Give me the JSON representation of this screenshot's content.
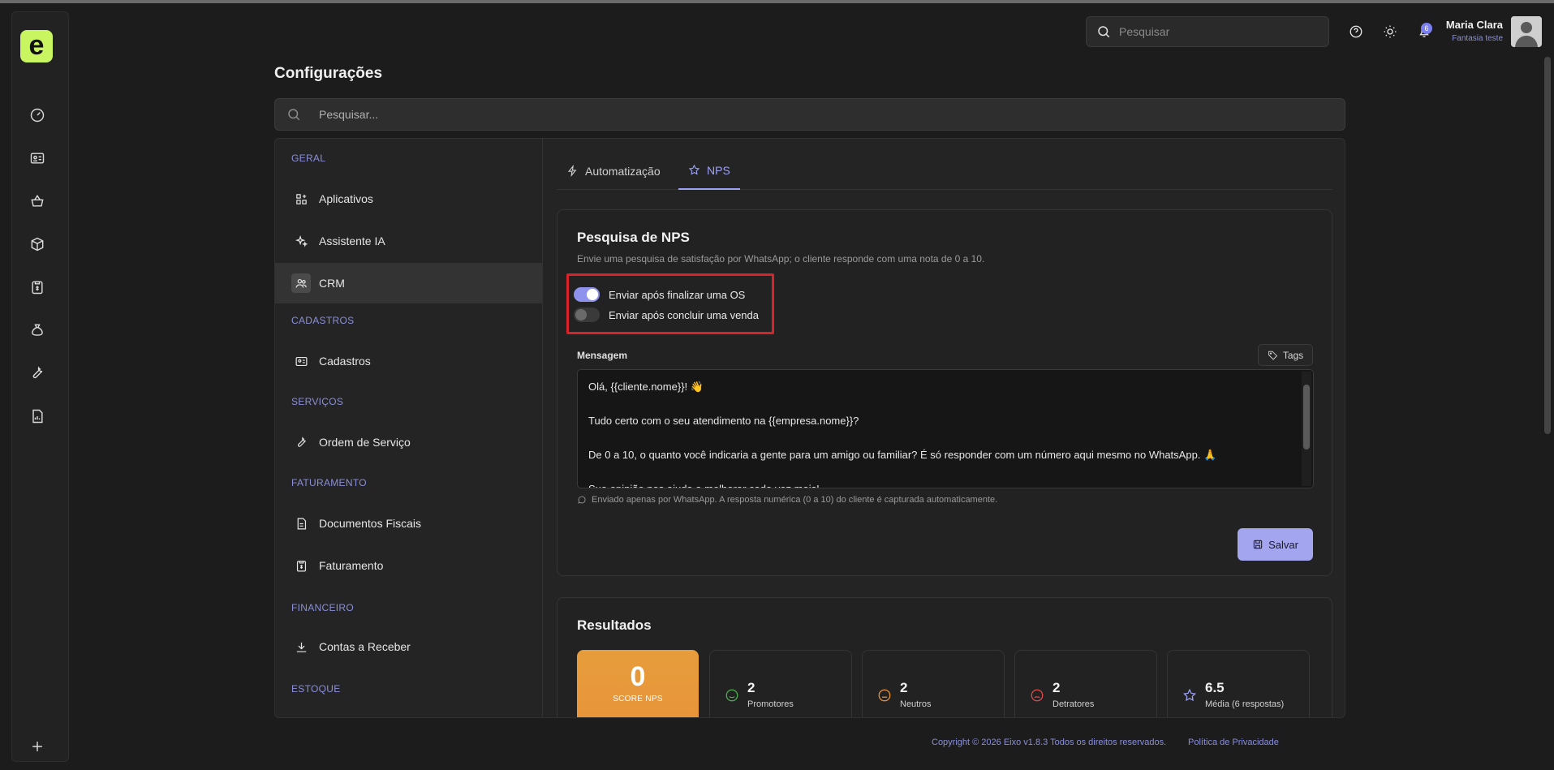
{
  "header": {
    "search_placeholder": "Pesquisar",
    "notifications_count": "6",
    "user_name": "Maria Clara",
    "user_company": "Fantasia teste"
  },
  "page": {
    "title": "Configurações",
    "search_placeholder": "Pesquisar..."
  },
  "sidebar": {
    "sections": [
      {
        "label": "GERAL"
      },
      {
        "label": "CADASTROS"
      },
      {
        "label": "SERVIÇOS"
      },
      {
        "label": "FATURAMENTO"
      },
      {
        "label": "FINANCEIRO"
      },
      {
        "label": "ESTOQUE"
      }
    ],
    "items": [
      {
        "label": "Aplicativos",
        "icon": "apps-icon"
      },
      {
        "label": "Assistente IA",
        "icon": "sparkles-icon"
      },
      {
        "label": "CRM",
        "icon": "users-icon",
        "active": true
      },
      {
        "label": "Cadastros",
        "icon": "id-card-icon"
      },
      {
        "label": "Ordem de Serviço",
        "icon": "wrench-icon"
      },
      {
        "label": "Documentos Fiscais",
        "icon": "document-icon"
      },
      {
        "label": "Faturamento",
        "icon": "clipboard-dollar-icon"
      },
      {
        "label": "Contas a Receber",
        "icon": "download-icon"
      }
    ]
  },
  "tabs": [
    {
      "label": "Automatização",
      "icon": "lightning-icon",
      "active": false
    },
    {
      "label": "NPS",
      "icon": "star-icon",
      "active": true
    }
  ],
  "nps": {
    "title": "Pesquisa de NPS",
    "description": "Envie uma pesquisa de satisfação por WhatsApp; o cliente responde com uma nota de 0 a 10.",
    "toggles": [
      {
        "label": "Enviar após finalizar uma OS",
        "on": true
      },
      {
        "label": "Enviar após concluir uma venda",
        "on": false
      }
    ],
    "message_label": "Mensagem",
    "tags_label": "Tags",
    "message_lines": [
      "Olá, {{cliente.nome}}! 👋",
      "",
      "Tudo certo com o seu atendimento na {{empresa.nome}}?",
      "",
      "De 0 a 10, o quanto você indicaria a gente para um amigo ou familiar? É só responder com um número aqui mesmo no WhatsApp. 🙏",
      "",
      "Sua opinião nos ajuda a melhorar cada vez mais!"
    ],
    "hint": "Enviado apenas por WhatsApp. A resposta numérica (0 a 10) do cliente é capturada automaticamente.",
    "save_label": "Salvar"
  },
  "results": {
    "title": "Resultados",
    "score_value": "0",
    "score_label": "SCORE NPS",
    "stats": [
      {
        "value": "2",
        "label": "Promotores",
        "icon": "smile-icon",
        "color": "#4caf50"
      },
      {
        "value": "2",
        "label": "Neutros",
        "icon": "neutral-face-icon",
        "color": "#e8923a"
      },
      {
        "value": "2",
        "label": "Detratores",
        "icon": "sad-face-icon",
        "color": "#e24b4b"
      },
      {
        "value": "6.5",
        "label": "Média (6 respostas)",
        "icon": "star-icon",
        "color": "#9ea2f5"
      }
    ]
  },
  "footer": {
    "copyright": "Copyright © 2026 Eixo v1.8.3 Todos os direitos reservados.",
    "privacy": "Política de Privacidade"
  },
  "colors": {
    "accent": "#9ea2f5",
    "logo": "#c8f560",
    "highlight": "#d8232a",
    "score": "#e8923a"
  }
}
